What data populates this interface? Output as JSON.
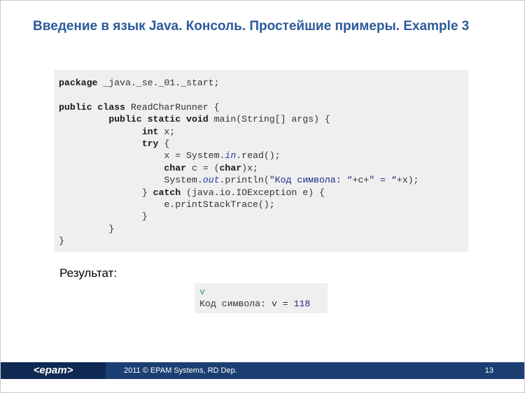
{
  "title": "Введение в язык Java. Консоль. Простейшие примеры. Example 3",
  "code": {
    "l1_kw": "package",
    "l1_rest": " _java._se._01._start;",
    "l3_kw": "public class",
    "l3_rest": " ReadCharRunner {",
    "l4_indent": "         ",
    "l4_kw": "public static void",
    "l4_rest": " main(String[] args) {",
    "l5_indent": "               ",
    "l5_kw": "int",
    "l5_rest": " x;",
    "l6_indent": "               ",
    "l6_kw": "try",
    "l6_rest": " {",
    "l7_a": "                   x = System.",
    "l7_it": "in",
    "l7_b": ".read();",
    "l8_indent": "                   ",
    "l8_kw1": "char",
    "l8_mid": " c = (",
    "l8_kw2": "char",
    "l8_end": ")x;",
    "l9_a": "                   System.",
    "l9_it": "out",
    "l9_b": ".println(",
    "l9_str1": "\"Код символа: “",
    "l9_c": "+c+",
    "l9_str2": "\" = “",
    "l9_d": "+x);",
    "l10_a": "               } ",
    "l10_kw": "catch",
    "l10_rest": " (java.io.IOException e) {",
    "l11": "                   e.printStackTrace();",
    "l12": "               }",
    "l13": "         }",
    "l14": "}"
  },
  "result_label": "Результат:",
  "output": {
    "echo": "v",
    "result_text": "Код символа: v = ",
    "result_value": "118"
  },
  "footer": {
    "logo": "<epam>",
    "text": "2011 © EPAM Systems, RD Dep.",
    "page": "13"
  },
  "colors": {
    "title": "#2b5a9a",
    "footer_bar": "#1c3f73",
    "code_bg": "#efefef"
  }
}
